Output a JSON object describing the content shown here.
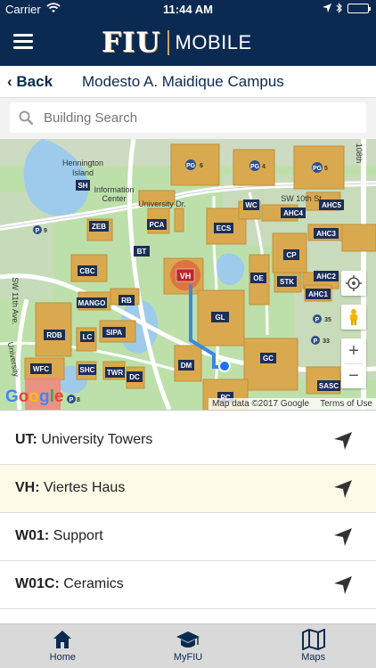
{
  "status_bar": {
    "carrier": "Carrier",
    "time": "11:44 AM"
  },
  "header": {
    "logo_text": "FIU",
    "app_name": "MOBILE",
    "menu_icon": "hamburger-icon"
  },
  "back_bar": {
    "back_label": "Back",
    "title": "Modesto A. Maidique Campus"
  },
  "search": {
    "placeholder": "Building Search",
    "icon": "search-icon"
  },
  "map": {
    "attribution": "Map data ©2017 Google",
    "terms": "Terms of Use",
    "zoom_in": "+",
    "zoom_out": "−",
    "google_logo": "Google",
    "labels": {
      "hennington": "Hennington",
      "island": "Island",
      "information": "Information",
      "center": "Center",
      "univ_dr": "University Dr.",
      "sw10": "SW 10th St",
      "sw11": "SW 11th Ave.",
      "univ": "University",
      "st108": "108th"
    },
    "buildings": {
      "sh": "SH",
      "zeb": "ZEB",
      "pca": "PCA",
      "bt": "BT",
      "ecs": "ECS",
      "wc": "WC",
      "ahc4": "AHC4",
      "ahc5": "AHC5",
      "ahc3": "AHC3",
      "cbc": "CBC",
      "vh": "VH",
      "cp": "CP",
      "oe": "OE",
      "stk": "STK",
      "ahc2": "AHC2",
      "ahc1": "AHC1",
      "mango": "MANGO",
      "rb": "RB",
      "gl": "GL",
      "rdb": "RDB",
      "lc": "LC",
      "sipa": "SIPA",
      "wfc": "WFC",
      "shc": "SHC",
      "twr": "TWR",
      "dc": "DC",
      "dm": "DM",
      "gc": "GC",
      "sasc": "SASC",
      "pc": "PC"
    },
    "parking": {
      "pg6": "6",
      "pg4": "4",
      "pg5": "5",
      "p9": "9",
      "p35": "35",
      "p33": "33",
      "p8": "8",
      "pg_prefix": "PG",
      "p_prefix": "P"
    }
  },
  "buildings_list": [
    {
      "code": "UT:",
      "name": "University Towers",
      "selected": false
    },
    {
      "code": "VH:",
      "name": "Viertes Haus",
      "selected": true
    },
    {
      "code": "W01:",
      "name": "Support",
      "selected": false
    },
    {
      "code": "W01C:",
      "name": "Ceramics",
      "selected": false
    }
  ],
  "tab_bar": [
    {
      "label": "Home",
      "icon": "home-icon"
    },
    {
      "label": "MyFIU",
      "icon": "graduation-cap-icon"
    },
    {
      "label": "Maps",
      "icon": "map-icon"
    }
  ],
  "colors": {
    "brand_navy": "#0b2a52",
    "brand_gold": "#c5a26a",
    "building": "#d9a94f",
    "selected_row": "#fdfbe8"
  }
}
